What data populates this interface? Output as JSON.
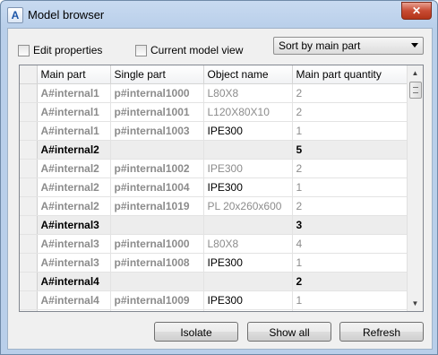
{
  "window": {
    "title": "Model browser",
    "close_glyph": "✕",
    "app_icon_glyph": "A"
  },
  "options": {
    "edit_properties": {
      "label": "Edit properties",
      "checked": false
    },
    "current_model_view": {
      "label": "Current model view",
      "checked": false
    },
    "sort_dropdown": {
      "selected": "Sort by main part"
    }
  },
  "table": {
    "columns": [
      "Main part",
      "Single part",
      "Object name",
      "Main part quantity"
    ],
    "rows": [
      {
        "type": "item",
        "main": "A#internal1",
        "single": "p#internal1000",
        "object": "L80X8",
        "qty": "2",
        "object_dim": true
      },
      {
        "type": "item",
        "main": "A#internal1",
        "single": "p#internal1001",
        "object": "L120X80X10",
        "qty": "2",
        "object_dim": true
      },
      {
        "type": "item",
        "main": "A#internal1",
        "single": "p#internal1003",
        "object": "IPE300",
        "qty": "1",
        "object_dim": false
      },
      {
        "type": "group",
        "main": "A#internal2",
        "single": "",
        "object": "",
        "qty": "5"
      },
      {
        "type": "item",
        "main": "A#internal2",
        "single": "p#internal1002",
        "object": "IPE300",
        "qty": "2",
        "object_dim": true
      },
      {
        "type": "item",
        "main": "A#internal2",
        "single": "p#internal1004",
        "object": "IPE300",
        "qty": "1",
        "object_dim": false
      },
      {
        "type": "item",
        "main": "A#internal2",
        "single": "p#internal1019",
        "object": "PL 20x260x600",
        "qty": "2",
        "object_dim": true
      },
      {
        "type": "group",
        "main": "A#internal3",
        "single": "",
        "object": "",
        "qty": "3"
      },
      {
        "type": "item",
        "main": "A#internal3",
        "single": "p#internal1000",
        "object": "L80X8",
        "qty": "4",
        "object_dim": true
      },
      {
        "type": "item",
        "main": "A#internal3",
        "single": "p#internal1008",
        "object": "IPE300",
        "qty": "1",
        "object_dim": false
      },
      {
        "type": "group",
        "main": "A#internal4",
        "single": "",
        "object": "",
        "qty": "2"
      },
      {
        "type": "item",
        "main": "A#internal4",
        "single": "p#internal1009",
        "object": "IPE300",
        "qty": "1",
        "object_dim": false
      },
      {
        "type": "item",
        "main": "",
        "single": "",
        "object": "",
        "qty": "",
        "object_dim": true
      }
    ]
  },
  "scrollbar": {
    "up_glyph": "▲",
    "down_glyph": "▼"
  },
  "buttons": {
    "isolate": "Isolate",
    "show_all": "Show all",
    "refresh": "Refresh"
  }
}
